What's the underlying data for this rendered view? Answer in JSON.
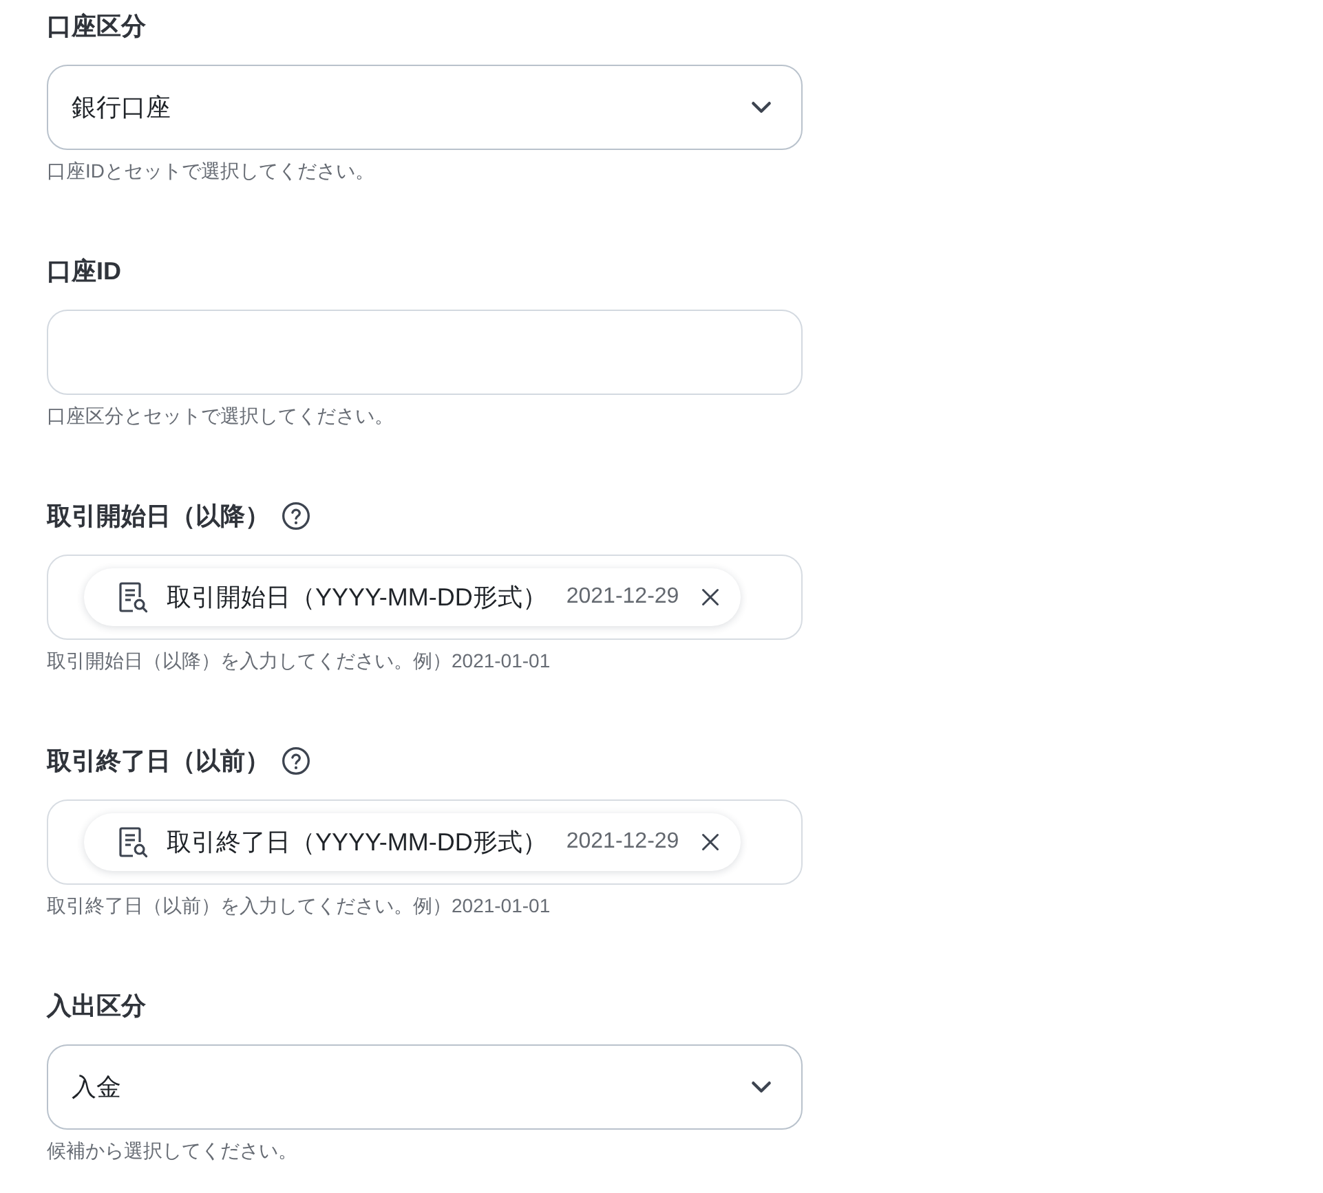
{
  "fields": [
    {
      "kind": "select",
      "label": "口座区分",
      "help": false,
      "value": "銀行口座",
      "hint": "口座IDとセットで選択してください。"
    },
    {
      "kind": "text",
      "label": "口座ID",
      "help": false,
      "hint": "口座区分とセットで選択してください。"
    },
    {
      "kind": "variable",
      "label": "取引開始日（以降）",
      "help": true,
      "chip": {
        "name": "取引開始日（YYYY-MM-DD形式）",
        "value": "2021-12-29"
      },
      "hint": "取引開始日（以降）を入力してください。例）2021-01-01"
    },
    {
      "kind": "variable",
      "label": "取引終了日（以前）",
      "help": true,
      "chip": {
        "name": "取引終了日（YYYY-MM-DD形式）",
        "value": "2021-12-29"
      },
      "hint": "取引終了日（以前）を入力してください。例）2021-01-01"
    },
    {
      "kind": "select",
      "label": "入出区分",
      "help": false,
      "value": "入金",
      "hint": "候補から選択してください。"
    }
  ]
}
